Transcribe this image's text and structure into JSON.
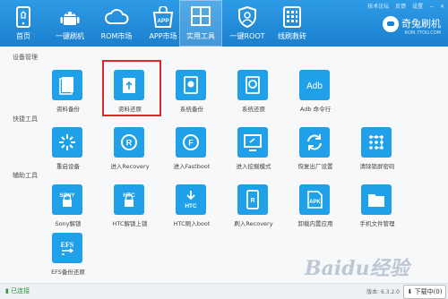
{
  "topbar": {
    "links": [
      "技术论坛",
      "反馈",
      "设置"
    ]
  },
  "nav": [
    {
      "label": "首页",
      "icon": "phone-home-icon"
    },
    {
      "label": "一键刷机",
      "icon": "robot-icon"
    },
    {
      "label": "ROM市场",
      "icon": "cloud-icon"
    },
    {
      "label": "APP市场",
      "icon": "app-bag-icon"
    },
    {
      "label": "实用工具",
      "icon": "grid-icon"
    },
    {
      "label": "一键ROOT",
      "icon": "shield-icon"
    },
    {
      "label": "线刷救砖",
      "icon": "brick-icon"
    }
  ],
  "brand": {
    "name": "奇兔刷机",
    "sub": "ROM.7TOU.COM"
  },
  "sections": [
    {
      "title": "设备管理",
      "items": [
        "资料备份",
        "资料还原",
        "系统备份",
        "系统还原",
        "Adb 命令行"
      ]
    },
    {
      "title": "快捷工具",
      "items": [
        "重启设备",
        "进入Recovery",
        "进入Fastboot",
        "进入挖掘模式",
        "恢复出厂设置",
        "清除锁屏密码"
      ]
    },
    {
      "title": "辅助工具",
      "items": [
        "Sony解锁",
        "HTC解锁上锁",
        "HTC刷入boot",
        "刷入Recovery",
        "卸载内置应用",
        "手机文件管理",
        "EFS备份还原"
      ]
    }
  ],
  "icon_text": {
    "adb": "Adb",
    "sony": "SONY",
    "htc1": "HTC",
    "htc2": "HTC",
    "apk": "APK",
    "efs": "EFS"
  },
  "status": {
    "connection": "已连接",
    "version": "版本: 6.3.2.0",
    "download": "下载中(0)"
  },
  "watermark": "Baidu经验",
  "colors": {
    "header": "#1a80cf",
    "tile": "#1fa0e8",
    "highlight": "#e0262a",
    "connected": "#2a9a3a"
  }
}
